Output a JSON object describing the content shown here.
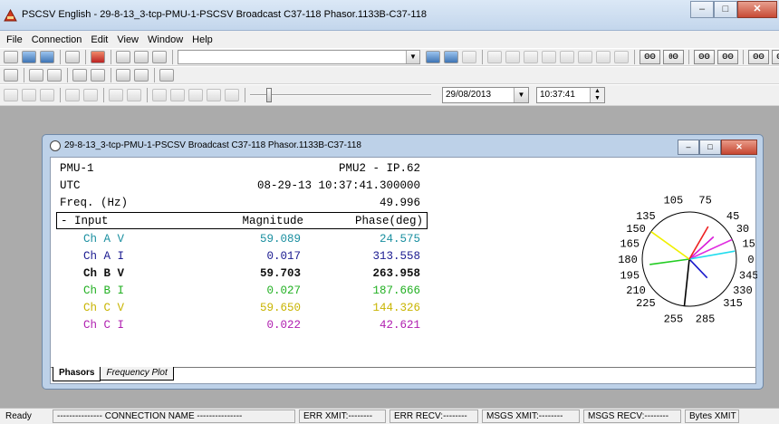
{
  "window": {
    "title": "PSCSV English - 29-8-13_3-tcp-PMU-1-PSCSV Broadcast C37-118 Phasor.1133B-C37-118",
    "minimize": "–",
    "maximize": "□",
    "close": "✕"
  },
  "menu": [
    "File",
    "Connection",
    "Edit",
    "View",
    "Window",
    "Help"
  ],
  "toolbar": {
    "big_buttons": [
      "ΘΘ",
      "θΘ",
      "ΘΘ",
      "ΘΘ",
      "ΘΘ",
      "ΘΘ"
    ],
    "date": "29/08/2013",
    "time": "10:37:41"
  },
  "child": {
    "title": "29-8-13_3-tcp-PMU-1-PSCSV Broadcast C37-118 Phasor.1133B-C37-118",
    "pmu_id": "PMU-1",
    "pmu_name": "PMU2 - IP.62",
    "time_label": "UTC",
    "time_value": "08-29-13 10:37:41.300000",
    "freq_label": "Freq. (Hz)",
    "freq_value": "49.996",
    "header": {
      "input": "- Input",
      "magnitude": "Magnitude",
      "phase": "Phase(deg)"
    },
    "channels": [
      {
        "name": "Ch A V",
        "magnitude": "59.089",
        "phase": "24.575",
        "color": "#1a8fa0"
      },
      {
        "name": "Ch A I",
        "magnitude": "0.017",
        "phase": "313.558",
        "color": "#1a1a90"
      },
      {
        "name": "Ch B V",
        "magnitude": "59.703",
        "phase": "263.958",
        "color": "#111111"
      },
      {
        "name": "Ch B I",
        "magnitude": "0.027",
        "phase": "187.666",
        "color": "#22b022"
      },
      {
        "name": "Ch C V",
        "magnitude": "59.650",
        "phase": "144.326",
        "color": "#c8b400"
      },
      {
        "name": "Ch C I",
        "magnitude": "0.022",
        "phase": "42.621",
        "color": "#b020b0"
      }
    ],
    "tabs": [
      "Phasors",
      "Frequency Plot"
    ],
    "dial_labels": [
      "0",
      "15",
      "30",
      "45",
      "75",
      "105",
      "135",
      "150",
      "165",
      "180",
      "195",
      "210",
      "225",
      "255",
      "285",
      "315",
      "330",
      "345"
    ],
    "phasors": [
      {
        "angle": 24.575,
        "color": "#e02ee0"
      },
      {
        "angle": 313.558,
        "color": "#1a1acc"
      },
      {
        "angle": 263.958,
        "color": "#000000"
      },
      {
        "angle": 187.666,
        "color": "#22cc22"
      },
      {
        "angle": 144.326,
        "color": "#f0f000"
      },
      {
        "angle": 42.621,
        "color": "#d81ad8"
      },
      {
        "angle": 10,
        "color": "#22ddee"
      },
      {
        "angle": 60,
        "color": "#ee2222"
      }
    ]
  },
  "status": {
    "ready": "Ready",
    "connection_name": "--------------- CONNECTION NAME ---------------",
    "err_xmit": "ERR XMIT:--------",
    "err_recv": "ERR RECV:--------",
    "msgs_xmit": "MSGS XMIT:--------",
    "msgs_recv": "MSGS RECV:--------",
    "bytes_xmit": "Bytes XMIT"
  }
}
